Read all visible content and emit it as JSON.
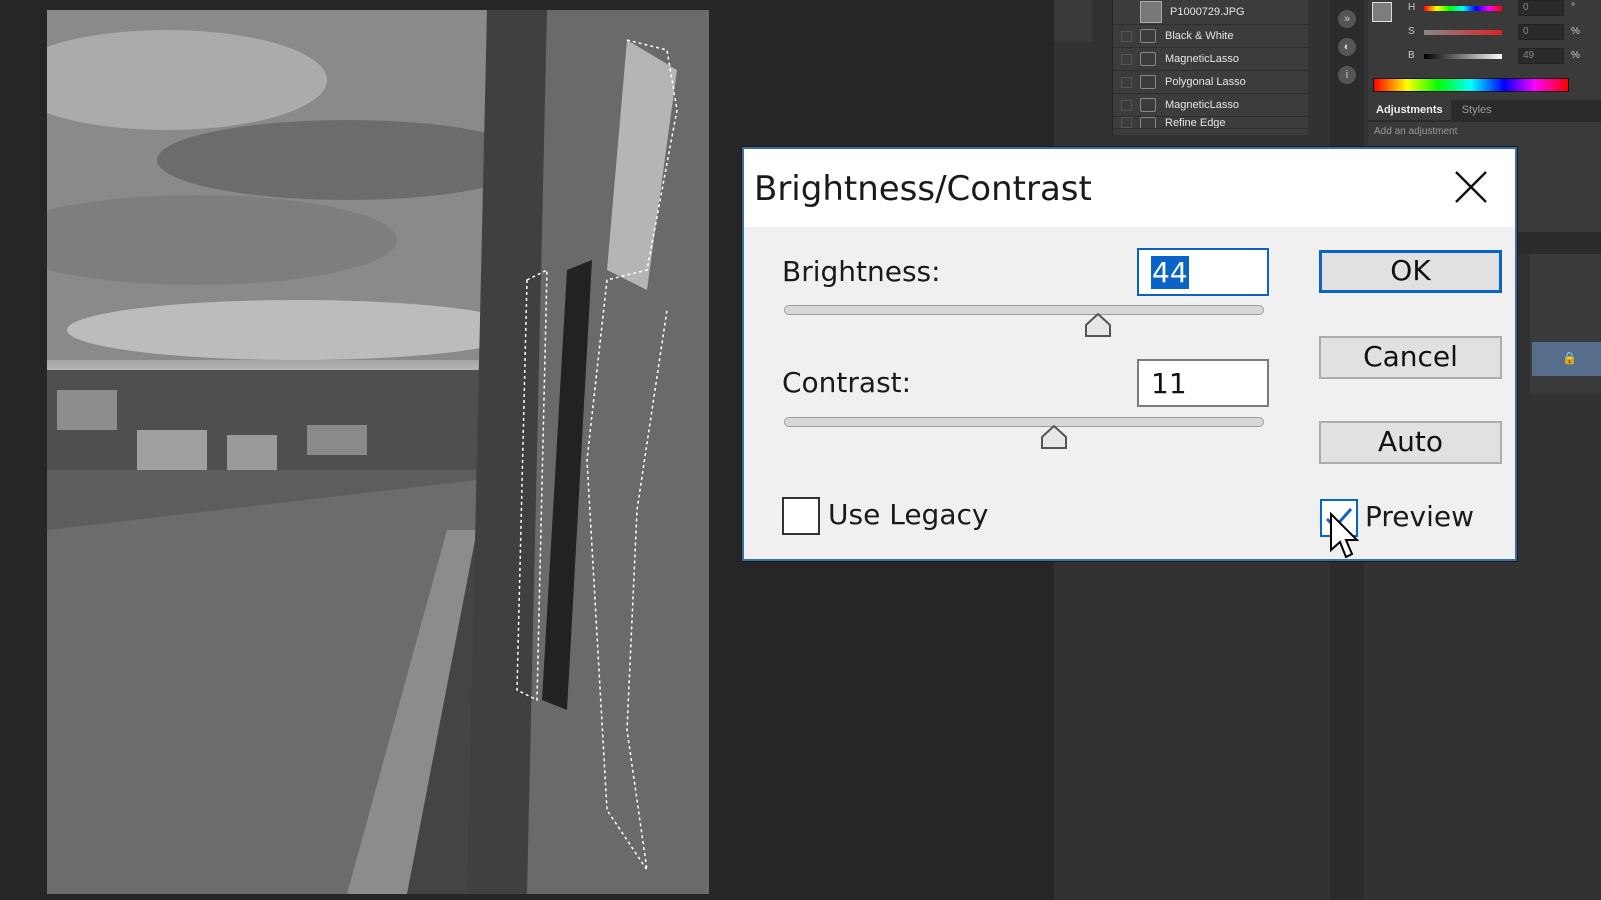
{
  "history": {
    "snapshot_name": "P1000729.JPG",
    "items": [
      {
        "label": "Black & White"
      },
      {
        "label": "MagneticLasso"
      },
      {
        "label": "Polygonal Lasso"
      },
      {
        "label": "MagneticLasso"
      },
      {
        "label": "Refine Edge"
      }
    ]
  },
  "color_panel": {
    "h": {
      "label": "H",
      "value": "0",
      "unit": "°"
    },
    "s": {
      "label": "S",
      "value": "0",
      "unit": "%"
    },
    "b": {
      "label": "B",
      "value": "49",
      "unit": "%"
    }
  },
  "adjustments": {
    "tabs": [
      "Adjustments",
      "Styles"
    ],
    "hint": "Add an adjustment"
  },
  "dialog": {
    "title": "Brightness/Contrast",
    "brightness_label": "Brightness:",
    "brightness_value": "44",
    "contrast_label": "Contrast:",
    "contrast_value": "11",
    "use_legacy_label": "Use Legacy",
    "use_legacy_checked": false,
    "preview_label": "Preview",
    "preview_checked": true,
    "ok_label": "OK",
    "cancel_label": "Cancel",
    "auto_label": "Auto"
  },
  "colors": {
    "accent": "#0a64c8",
    "panel_bg": "#323232",
    "workspace_bg": "#262626"
  }
}
